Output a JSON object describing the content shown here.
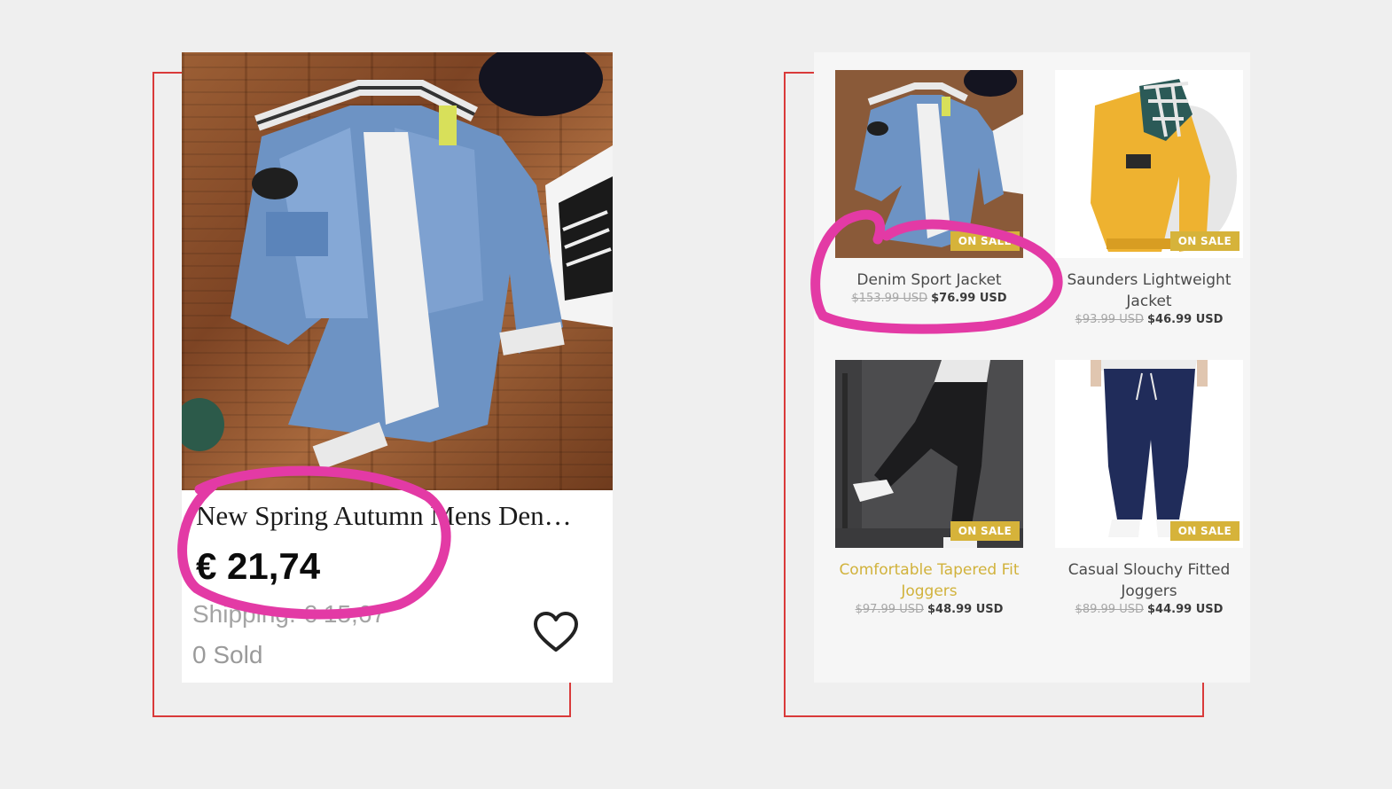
{
  "colors": {
    "frame": "#d93a3a",
    "highlight": "#e33aa5",
    "badge": "#d6b33a",
    "gold_link": "#d1b23b"
  },
  "left_listing": {
    "title": "New Spring Autumn Mens Den…",
    "price": "€ 21,74",
    "shipping": "Shipping: € 15,67",
    "sold": "0 Sold",
    "favorite_icon": "heart-outline-icon"
  },
  "right_store": {
    "products": [
      {
        "name": "Denim Sport Jacket",
        "old_price": "$153.99 USD",
        "new_price": "$76.99 USD",
        "badge": "ON SALE"
      },
      {
        "name": "Saunders Lightweight Jacket",
        "old_price": "$93.99 USD",
        "new_price": "$46.99 USD",
        "badge": "ON SALE"
      },
      {
        "name": "Comfortable Tapered Fit Joggers",
        "old_price": "$97.99 USD",
        "new_price": "$48.99 USD",
        "badge": "ON SALE"
      },
      {
        "name": "Casual Slouchy Fitted Joggers",
        "old_price": "$89.99 USD",
        "new_price": "$44.99 USD",
        "badge": "ON SALE"
      }
    ]
  }
}
